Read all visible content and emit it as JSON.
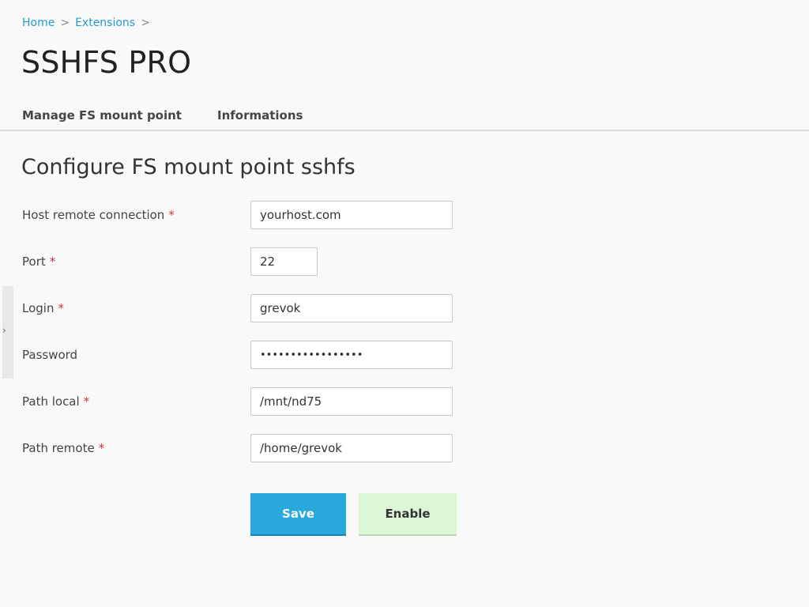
{
  "breadcrumb": {
    "items": [
      "Home",
      "Extensions"
    ],
    "separator": ">"
  },
  "page": {
    "title": "SSHFS PRO"
  },
  "tabs": [
    {
      "label": "Manage FS mount point"
    },
    {
      "label": "Informations"
    }
  ],
  "section": {
    "title": "Configure FS mount point sshfs"
  },
  "form": {
    "required_marker": "*",
    "fields": [
      {
        "label": "Host remote connection",
        "required": true,
        "value": "yourhost.com",
        "type": "text"
      },
      {
        "label": "Port",
        "required": true,
        "value": "22",
        "type": "text"
      },
      {
        "label": "Login",
        "required": true,
        "value": "grevok",
        "type": "text"
      },
      {
        "label": "Password",
        "required": false,
        "value": "grevokpassword123",
        "type": "password"
      },
      {
        "label": "Path local",
        "required": true,
        "value": "/mnt/nd75",
        "type": "text"
      },
      {
        "label": "Path remote",
        "required": true,
        "value": "/home/grevok",
        "type": "text"
      }
    ]
  },
  "buttons": {
    "save_label": "Save",
    "enable_label": "Enable"
  },
  "side_panel": {
    "toggle_icon": "chevron-right-icon"
  },
  "colors": {
    "link": "#259ccc",
    "save_button": "#29a8dd",
    "enable_button": "#dcf5d5",
    "required_marker": "#cc3344"
  }
}
